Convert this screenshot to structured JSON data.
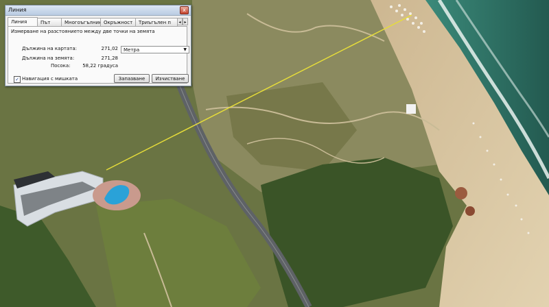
{
  "dialog": {
    "title": "Линия",
    "close_glyph": "x",
    "tabs": [
      "Линия",
      "Път",
      "Многоъгълник",
      "Окръжност",
      "Триъгълен п"
    ],
    "tab_prev": "◂",
    "tab_next": "▸",
    "description": "Измерване на разстоянието между две точки на земята",
    "map_length_label": "Дължина на картата:",
    "map_length_value": "271,02",
    "ground_length_label": "Дължина на земята:",
    "ground_length_value": "271,28",
    "heading_label": "Посока:",
    "heading_value": "58,22 градуса",
    "unit_selected": "Метра",
    "mouse_nav_label": "Навигация с мишката",
    "mouse_nav_checked": true,
    "save_label": "Запазване",
    "clear_label": "Изчистване"
  },
  "map": {
    "view": "satellite",
    "measure_line_color": "#e6dd3a",
    "sea_color": "#2f6f62",
    "sand_color": "#d9c7a2",
    "vegetation_color": "#4f6b33"
  }
}
